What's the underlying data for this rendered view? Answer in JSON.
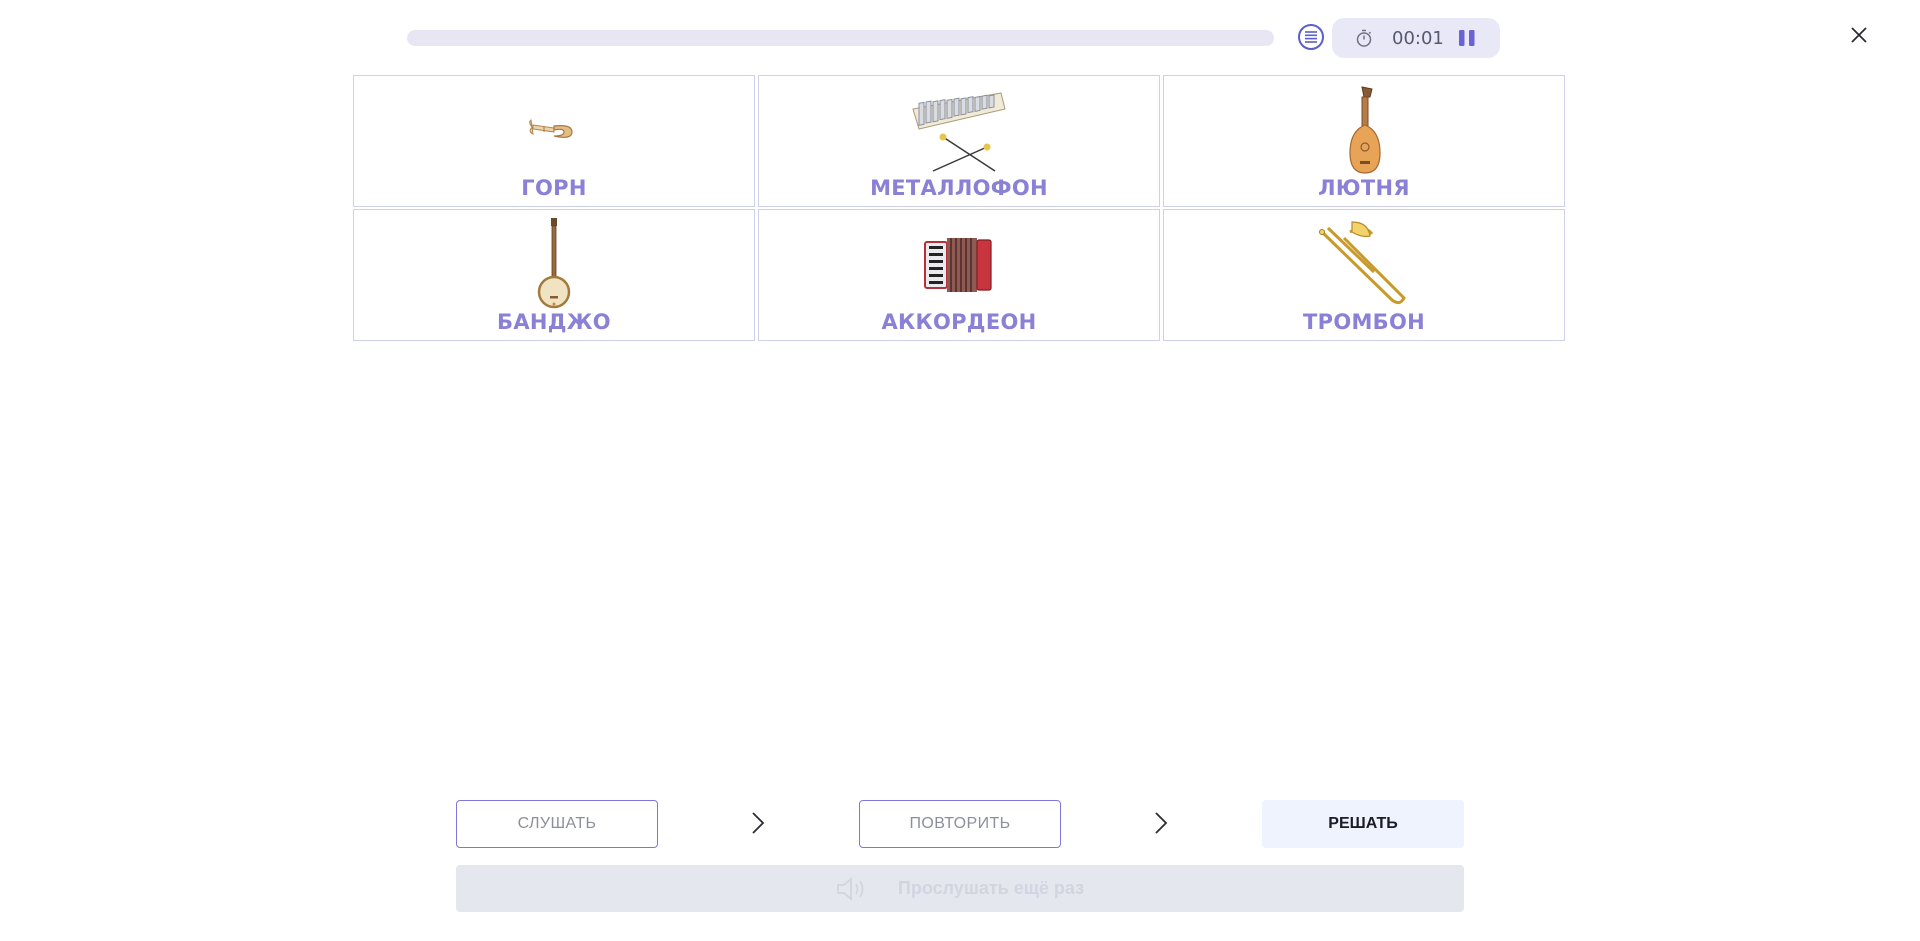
{
  "progress": {
    "fraction": 0.0
  },
  "timer": {
    "value": "00:01"
  },
  "icons": {
    "list": "list-icon",
    "stopwatch": "stopwatch-icon",
    "pause": "pause-icon",
    "close": "close-icon",
    "arrow": "chevron-right-icon",
    "speaker": "speaker-icon"
  },
  "colors": {
    "accent": "#8076d9",
    "label": "#8a80d6",
    "card_border": "#cfd0ea"
  },
  "cards": [
    {
      "label": "ГОРН",
      "icon": "bugle-icon"
    },
    {
      "label": "МЕТАЛЛОФОН",
      "icon": "metallophone-icon"
    },
    {
      "label": "ЛЮТНЯ",
      "icon": "lute-icon"
    },
    {
      "label": "БАНДЖО",
      "icon": "banjo-icon"
    },
    {
      "label": "АККОРДЕОН",
      "icon": "accordion-icon"
    },
    {
      "label": "ТРОМБОН",
      "icon": "trombone-icon"
    }
  ],
  "controls": {
    "listen_label": "СЛУШАТЬ",
    "repeat_label": "ПОВТОРИТЬ",
    "solve_label": "РЕШАТЬ",
    "listen_again_label": "Прослушать ещё раз"
  }
}
